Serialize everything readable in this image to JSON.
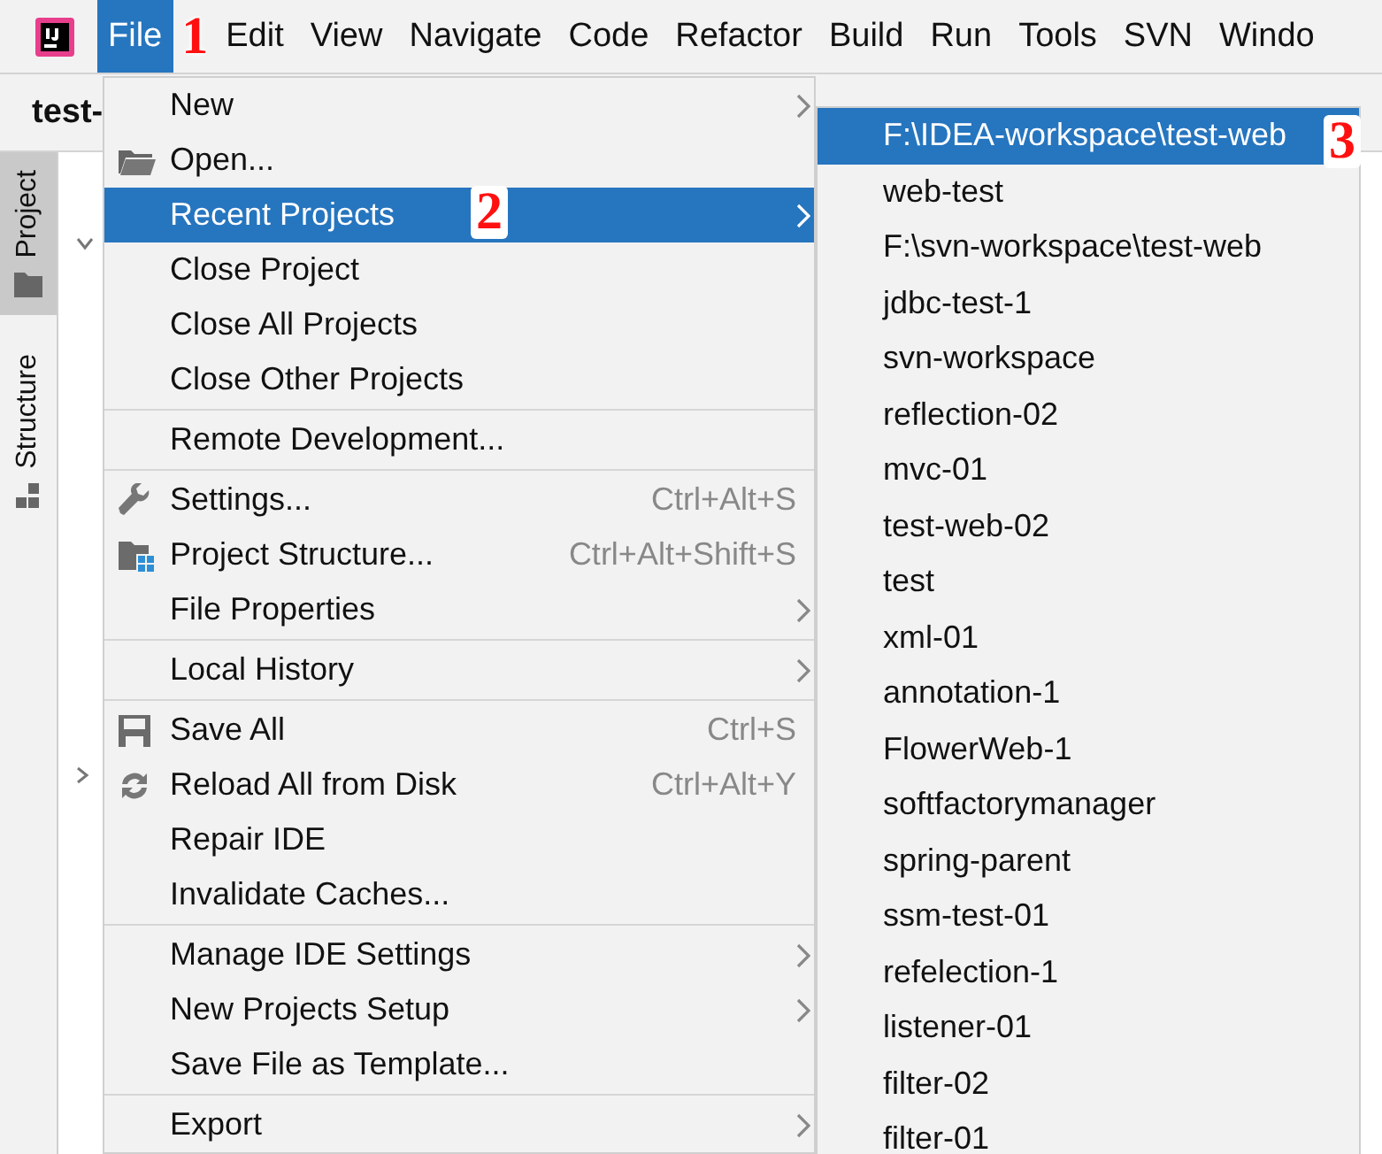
{
  "menubar": [
    {
      "label": "File",
      "selected": true
    },
    {
      "label": "Edit",
      "selected": false
    },
    {
      "label": "View",
      "selected": false
    },
    {
      "label": "Navigate",
      "selected": false
    },
    {
      "label": "Code",
      "selected": false
    },
    {
      "label": "Refactor",
      "selected": false
    },
    {
      "label": "Build",
      "selected": false
    },
    {
      "label": "Run",
      "selected": false
    },
    {
      "label": "Tools",
      "selected": false
    },
    {
      "label": "SVN",
      "selected": false
    },
    {
      "label": "Windo",
      "selected": false
    }
  ],
  "project_title": "test-",
  "tool_tabs": [
    {
      "label": "Project",
      "selected": true
    },
    {
      "label": "Structure",
      "selected": false
    }
  ],
  "file_menu": [
    [
      {
        "label": "New",
        "submenu": true,
        "selected": false
      },
      {
        "label": "Open...",
        "submenu": false,
        "selected": false
      },
      {
        "label": "Recent Projects",
        "submenu": true,
        "selected": true
      },
      {
        "label": "Close Project",
        "submenu": false,
        "selected": false
      },
      {
        "label": "Close All Projects",
        "submenu": false,
        "selected": false
      },
      {
        "label": "Close Other Projects",
        "submenu": false,
        "selected": false
      }
    ],
    [
      {
        "label": "Remote Development...",
        "submenu": false,
        "selected": false
      }
    ],
    [
      {
        "label": "Settings...",
        "shortcut": "Ctrl+Alt+S",
        "submenu": false,
        "selected": false
      },
      {
        "label": "Project Structure...",
        "shortcut": "Ctrl+Alt+Shift+S",
        "submenu": false,
        "selected": false
      },
      {
        "label": "File Properties",
        "submenu": true,
        "selected": false
      }
    ],
    [
      {
        "label": "Local History",
        "submenu": true,
        "selected": false
      }
    ],
    [
      {
        "label": "Save All",
        "shortcut": "Ctrl+S",
        "submenu": false,
        "selected": false
      },
      {
        "label": "Reload All from Disk",
        "shortcut": "Ctrl+Alt+Y",
        "submenu": false,
        "selected": false
      },
      {
        "label": "Repair IDE",
        "submenu": false,
        "selected": false
      },
      {
        "label": "Invalidate Caches...",
        "submenu": false,
        "selected": false
      }
    ],
    [
      {
        "label": "Manage IDE Settings",
        "submenu": true,
        "selected": false
      },
      {
        "label": "New Projects Setup",
        "submenu": true,
        "selected": false
      },
      {
        "label": "Save File as Template...",
        "submenu": false,
        "selected": false
      }
    ],
    [
      {
        "label": "Export",
        "submenu": true,
        "selected": false
      }
    ]
  ],
  "recent_projects": [
    {
      "label": "F:\\IDEA-workspace\\test-web",
      "selected": true
    },
    {
      "label": "web-test",
      "selected": false
    },
    {
      "label": "F:\\svn-workspace\\test-web",
      "selected": false
    },
    {
      "label": "jdbc-test-1",
      "selected": false
    },
    {
      "label": "svn-workspace",
      "selected": false
    },
    {
      "label": "reflection-02",
      "selected": false
    },
    {
      "label": "mvc-01",
      "selected": false
    },
    {
      "label": "test-web-02",
      "selected": false
    },
    {
      "label": "test",
      "selected": false
    },
    {
      "label": "xml-01",
      "selected": false
    },
    {
      "label": "annotation-1",
      "selected": false
    },
    {
      "label": "FlowerWeb-1",
      "selected": false
    },
    {
      "label": "softfactorymanager",
      "selected": false
    },
    {
      "label": "spring-parent",
      "selected": false
    },
    {
      "label": "ssm-test-01",
      "selected": false
    },
    {
      "label": "refelection-1",
      "selected": false
    },
    {
      "label": "listener-01",
      "selected": false
    },
    {
      "label": "filter-02",
      "selected": false
    },
    {
      "label": "filter-01",
      "selected": false
    }
  ],
  "annotations": [
    "1",
    "2",
    "3"
  ]
}
